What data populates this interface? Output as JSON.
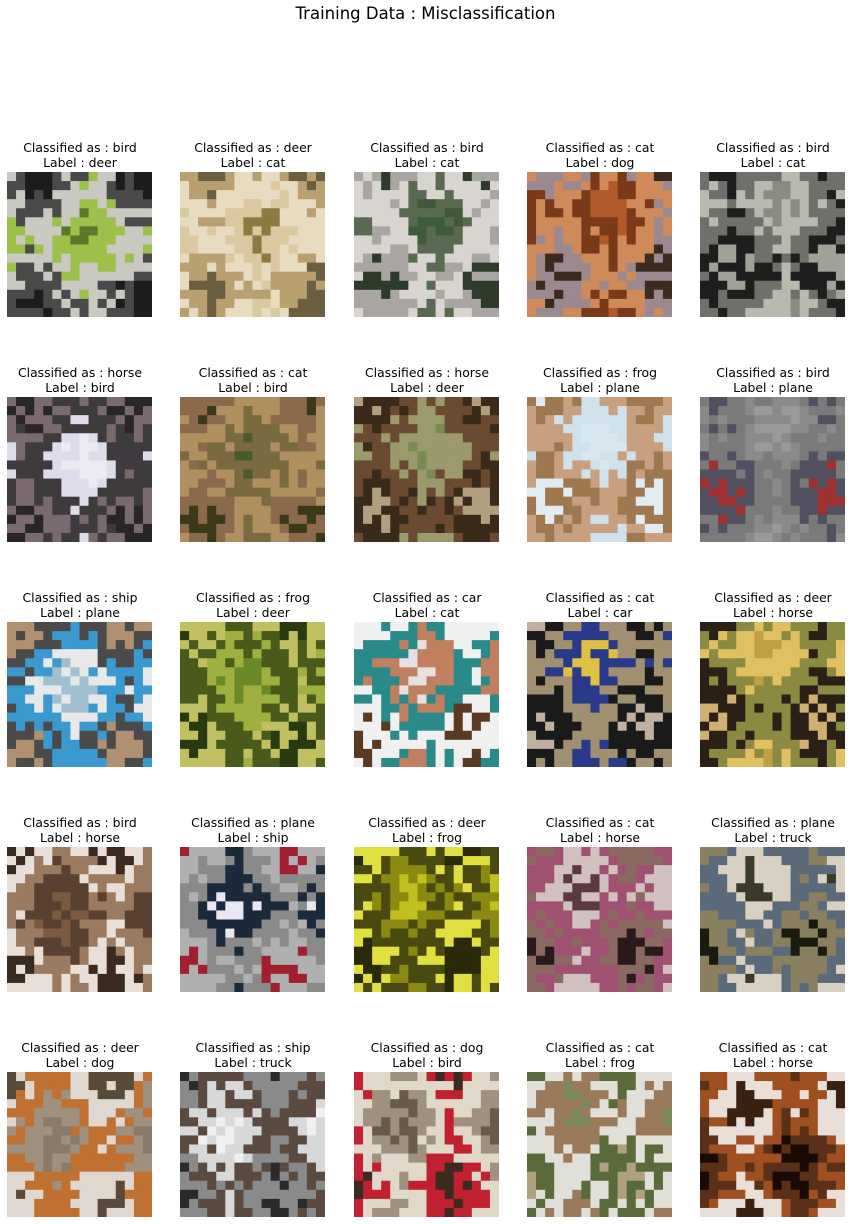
{
  "figure": {
    "title": "Training Data : Misclassification"
  },
  "grid": {
    "rows": [
      [
        {
          "predicted": "Classified as : bird",
          "label": "Label : deer",
          "image": "dark-cat-on-stairs-with-green-bush",
          "colors": [
            "#5a7a2a",
            "#9cc04a",
            "#c9c9c2",
            "#4a4a4a",
            "#1c1c1c"
          ]
        },
        {
          "predicted": "Classified as : deer",
          "label": "Label : cat",
          "image": "cream-cat-close-up",
          "colors": [
            "#8c7a42",
            "#d9c8a0",
            "#e8dcc0",
            "#b8a070",
            "#6a6040"
          ]
        },
        {
          "predicted": "Classified as : bird",
          "label": "Label : cat",
          "image": "white-cat-green-background",
          "colors": [
            "#3f5a3a",
            "#5a6a50",
            "#d8d4cf",
            "#a9a5a0",
            "#2e3a2a"
          ]
        },
        {
          "predicted": "Classified as : cat",
          "label": "Label : dog",
          "image": "brown-dog-face-on-blanket",
          "colors": [
            "#b05a2a",
            "#7a3a1a",
            "#d08a5a",
            "#9a8a90",
            "#3a2a20"
          ]
        },
        {
          "predicted": "Classified as : bird",
          "label": "Label : cat",
          "image": "black-cat-on-grey-road",
          "colors": [
            "#8a8c82",
            "#b8bab0",
            "#6e706a",
            "#1e1e1e",
            "#a0a298"
          ]
        }
      ],
      [
        {
          "predicted": "Classified as : horse",
          "label": "Label : bird",
          "image": "dark-bird-reflection-on-white",
          "colors": [
            "#ecebf4",
            "#dcdcea",
            "#3e3a3e",
            "#7a6a70",
            "#2a2628"
          ]
        },
        {
          "predicted": "Classified as : cat",
          "label": "Label : bird",
          "image": "brown-bird-on-grass",
          "colors": [
            "#4a5a2a",
            "#7a6a40",
            "#b09060",
            "#8a6a4a",
            "#3a3a1a"
          ]
        },
        {
          "predicted": "Classified as : horse",
          "label": "Label : deer",
          "image": "deer-grazing-in-field",
          "colors": [
            "#7a8a50",
            "#9a9a6a",
            "#6a4a30",
            "#3a2a1a",
            "#b0a080"
          ]
        },
        {
          "predicted": "Classified as : frog",
          "label": "Label : plane",
          "image": "airplane-in-pale-sky",
          "colors": [
            "#d8e8f0",
            "#cfe2ec",
            "#c8a080",
            "#a07850",
            "#e0ecf2"
          ]
        },
        {
          "predicted": "Classified as : bird",
          "label": "Label : plane",
          "image": "small-jet-over-grey-ground",
          "colors": [
            "#9a9a9a",
            "#8a8a8a",
            "#7a7a7a",
            "#505060",
            "#a03030"
          ]
        }
      ],
      [
        {
          "predicted": "Classified as : ship",
          "label": "Label : plane",
          "image": "white-blue-vehicle-near-building",
          "colors": [
            "#a0c0d0",
            "#e8e8e8",
            "#3a9ad0",
            "#4a4a4a",
            "#b09070"
          ]
        },
        {
          "predicted": "Classified as : frog",
          "label": "Label : deer",
          "image": "green-foliage-texture",
          "colors": [
            "#6a8a2a",
            "#a0b040",
            "#4a5a1a",
            "#c0c060",
            "#2a3a10"
          ]
        },
        {
          "predicted": "Classified as : car",
          "label": "Label : cat",
          "image": "cat-with-teal-bowl",
          "colors": [
            "#e8e0e0",
            "#c08060",
            "#2a8a8a",
            "#f0f0f0",
            "#5a3a20"
          ]
        },
        {
          "predicted": "Classified as : cat",
          "label": "Label : car",
          "image": "black-car-striped-wall",
          "colors": [
            "#e0c040",
            "#2a3a8a",
            "#a09070",
            "#1a1a1a",
            "#c0b0a0"
          ]
        },
        {
          "predicted": "Classified as : deer",
          "label": "Label : horse",
          "image": "dark-horse-in-autumn-field",
          "colors": [
            "#c0a040",
            "#e0c060",
            "#8a8a40",
            "#2a2018",
            "#d0b070"
          ]
        }
      ],
      [
        {
          "predicted": "Classified as : bird",
          "label": "Label : horse",
          "image": "horse-head-close-up",
          "colors": [
            "#7a5a40",
            "#5a4030",
            "#9a7a60",
            "#e8e0d8",
            "#3a2a20"
          ]
        },
        {
          "predicted": "Classified as : plane",
          "label": "Label : ship",
          "image": "boat-on-trailer-in-lot",
          "colors": [
            "#e8e8f0",
            "#1a2a3a",
            "#8a8a8a",
            "#b0b0b0",
            "#a02030"
          ]
        },
        {
          "predicted": "Classified as : deer",
          "label": "Label : frog",
          "image": "frog-in-yellow-leaves",
          "colors": [
            "#c0c020",
            "#8a8a10",
            "#4a4a10",
            "#e0e040",
            "#2a2a0a"
          ]
        },
        {
          "predicted": "Classified as : cat",
          "label": "Label : horse",
          "image": "horse-face-with-bridle",
          "colors": [
            "#5a3a40",
            "#d0c0c0",
            "#a05070",
            "#8a6a60",
            "#2a1a1a"
          ]
        },
        {
          "predicted": "Classified as : plane",
          "label": "Label : truck",
          "image": "truck-blurred-outdoors",
          "colors": [
            "#3a3a2a",
            "#d8d0c0",
            "#5a6a7a",
            "#8a8060",
            "#1a1a10"
          ]
        }
      ],
      [
        {
          "predicted": "Classified as : deer",
          "label": "Label : dog",
          "image": "orange-dog-jumping",
          "colors": [
            "#8a7a6a",
            "#a09080",
            "#c07030",
            "#e0d8d0",
            "#5a4a3a"
          ]
        },
        {
          "predicted": "Classified as : ship",
          "label": "Label : truck",
          "image": "white-truck-side",
          "colors": [
            "#f0f0f0",
            "#d8d8d8",
            "#5a4a40",
            "#8a8a8a",
            "#2a2a2a"
          ]
        },
        {
          "predicted": "Classified as : dog",
          "label": "Label : bird",
          "image": "owl-face-with-red-collar",
          "colors": [
            "#6a5a4a",
            "#a09080",
            "#e0d8c8",
            "#c02030",
            "#3a2a20"
          ]
        },
        {
          "predicted": "Classified as : cat",
          "label": "Label : frog",
          "image": "frog-next-to-banknote",
          "colors": [
            "#7a8a5a",
            "#9a7a5a",
            "#e0e0d8",
            "#5a6a3a",
            "#b0a080"
          ]
        },
        {
          "predicted": "Classified as : cat",
          "label": "Label : horse",
          "image": "white-brown-horse-dark-background",
          "colors": [
            "#3a2010",
            "#e8e0d8",
            "#a05020",
            "#5a3018",
            "#1a0a05"
          ]
        }
      ]
    ]
  }
}
